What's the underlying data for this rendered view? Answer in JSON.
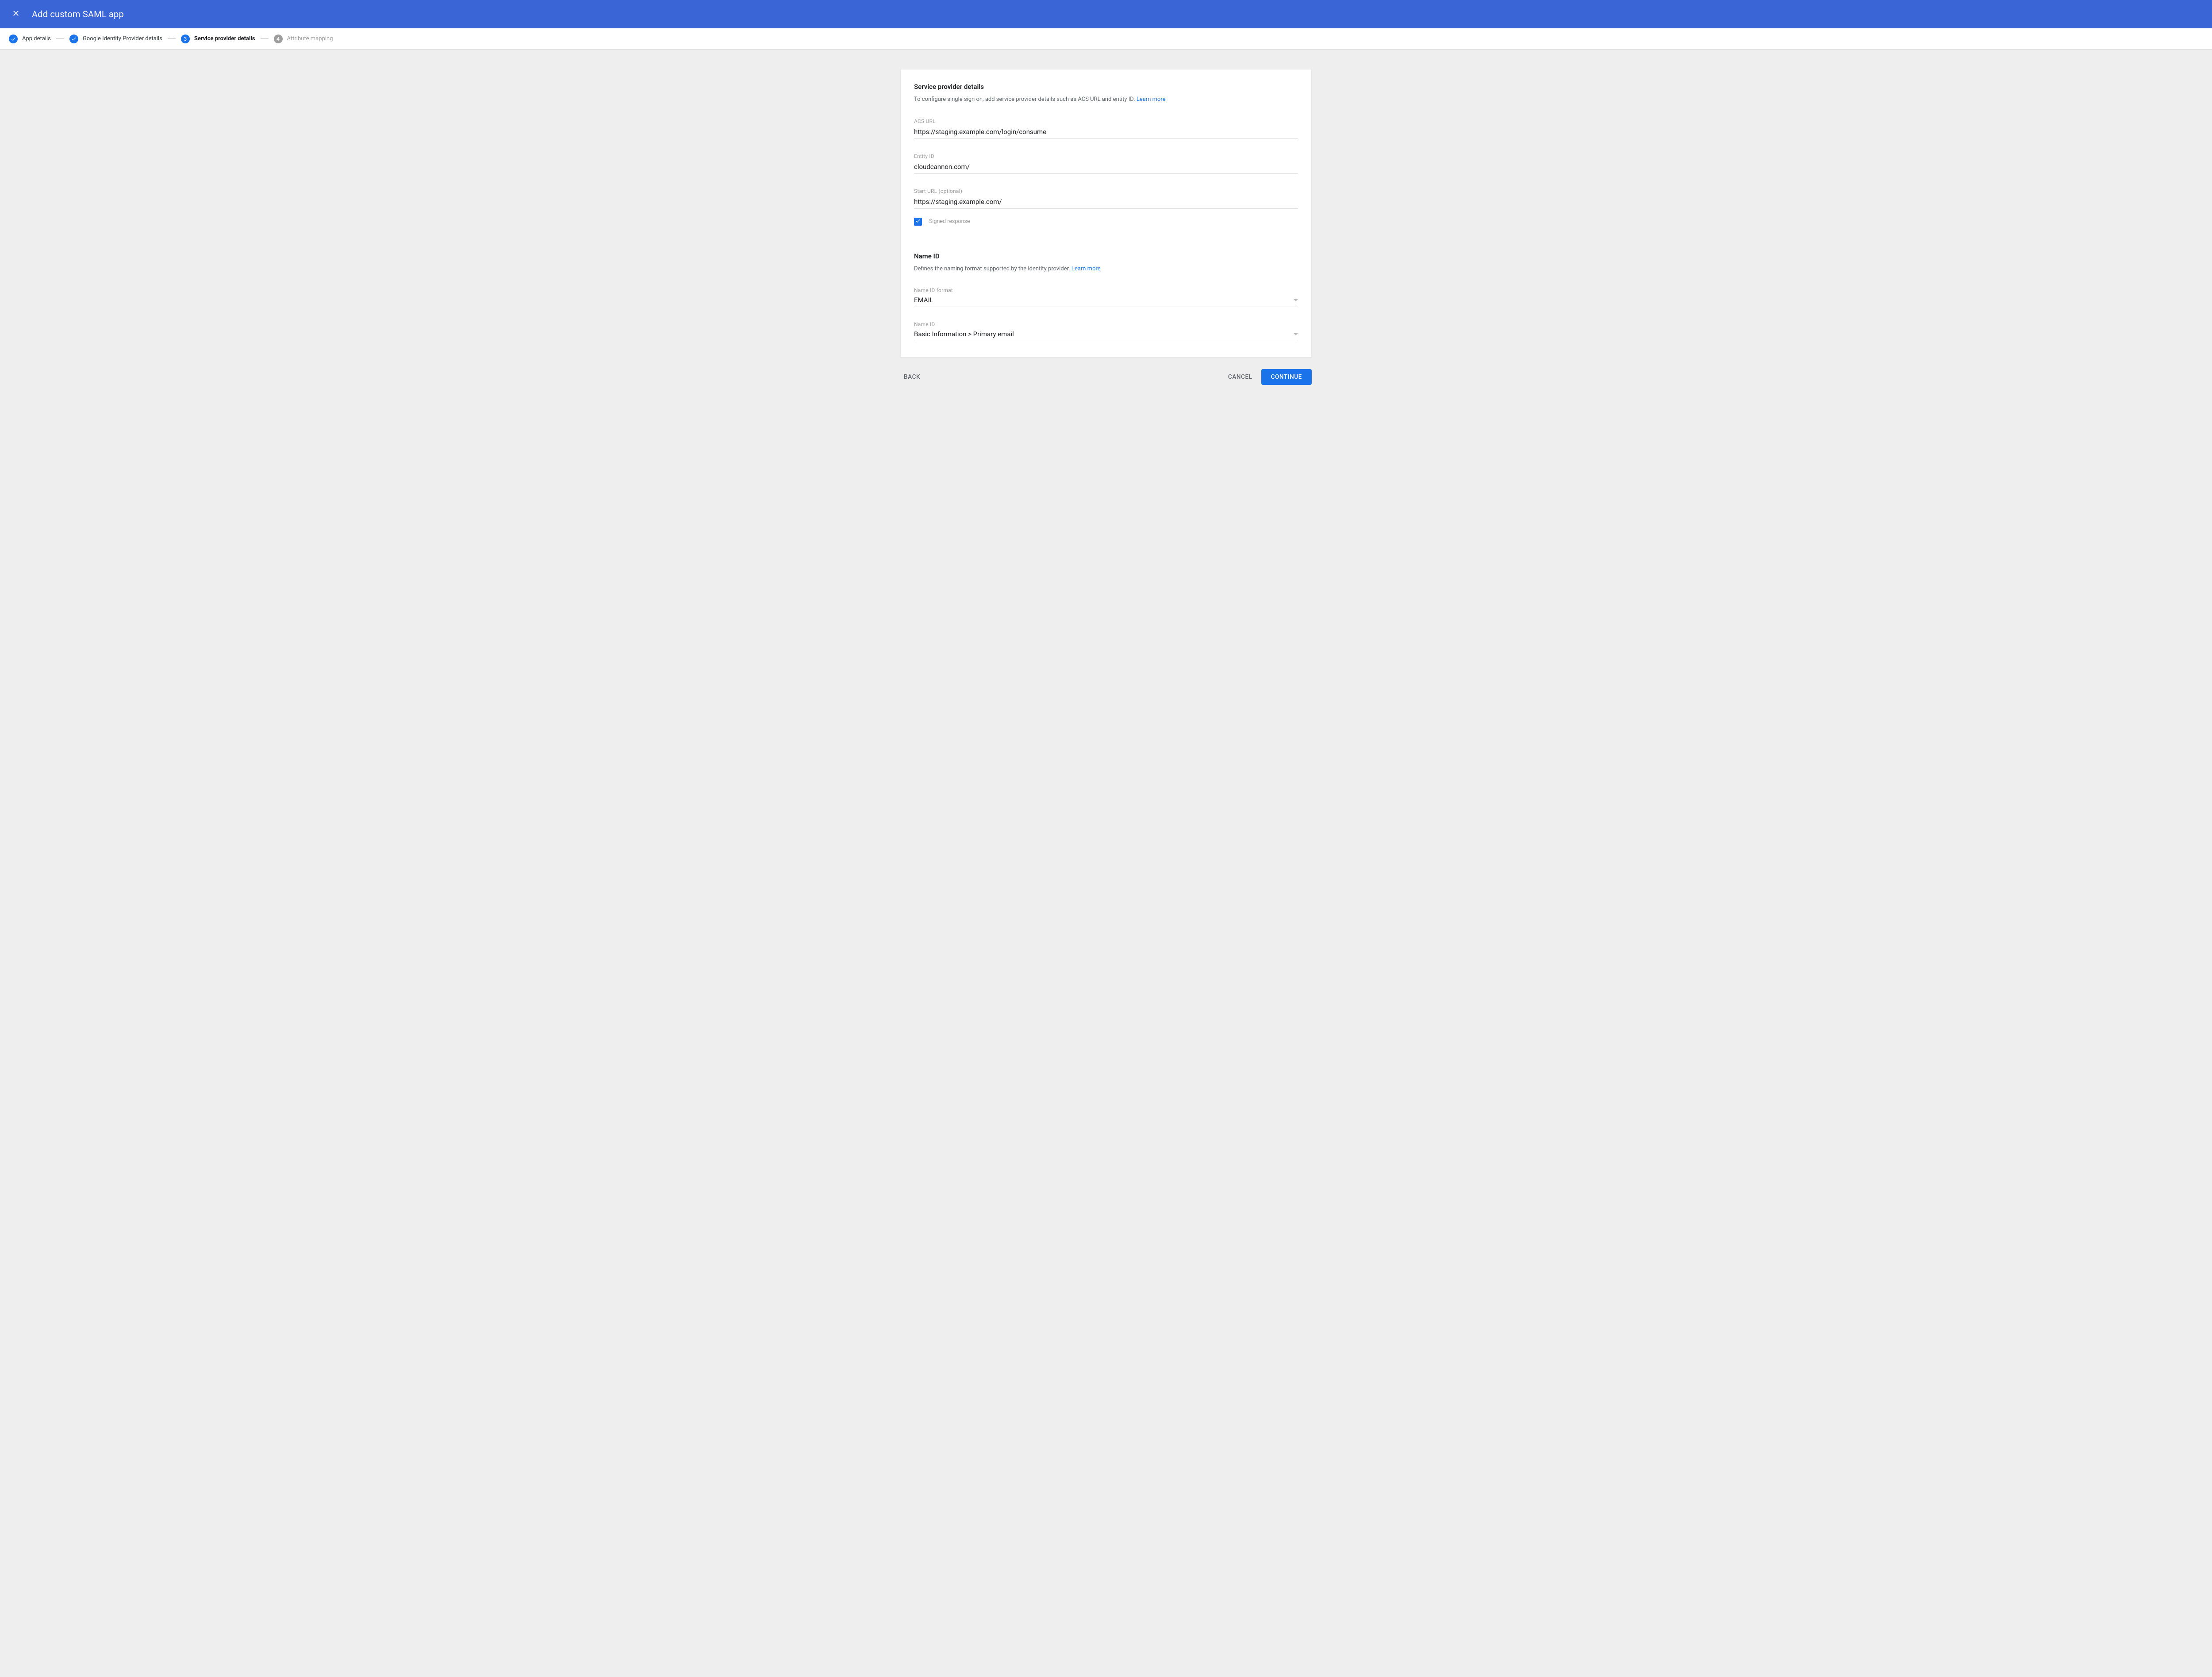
{
  "header": {
    "title": "Add custom SAML app"
  },
  "stepper": {
    "steps": [
      {
        "label": "App details",
        "state": "done"
      },
      {
        "label": "Google Identity Provider details",
        "state": "done"
      },
      {
        "label": "Service provider details",
        "number": "3",
        "state": "active"
      },
      {
        "label": "Attribute mapping",
        "number": "4",
        "state": "pending"
      }
    ]
  },
  "section_sp": {
    "title": "Service provider details",
    "desc": "To configure single sign on, add service provider details such as ACS URL and entity ID. ",
    "learn_more": "Learn more"
  },
  "fields": {
    "acs_url": {
      "label": "ACS URL",
      "value": "https://staging.example.com/login/consume"
    },
    "entity_id": {
      "label": "Entity ID",
      "value": "cloudcannon.com/"
    },
    "start_url": {
      "label": "Start URL (optional)",
      "value": "https://staging.example.com/"
    },
    "signed_response": {
      "label": "Signed response",
      "checked": true
    }
  },
  "section_nameid": {
    "title": "Name ID",
    "desc": "Defines the naming format supported by the identity provider. ",
    "learn_more": "Learn more",
    "format": {
      "label": "Name ID format",
      "value": "EMAIL"
    },
    "nameid": {
      "label": "Name ID",
      "value": "Basic Information > Primary email"
    }
  },
  "footer": {
    "back": "BACK",
    "cancel": "CANCEL",
    "continue": "CONTINUE"
  }
}
